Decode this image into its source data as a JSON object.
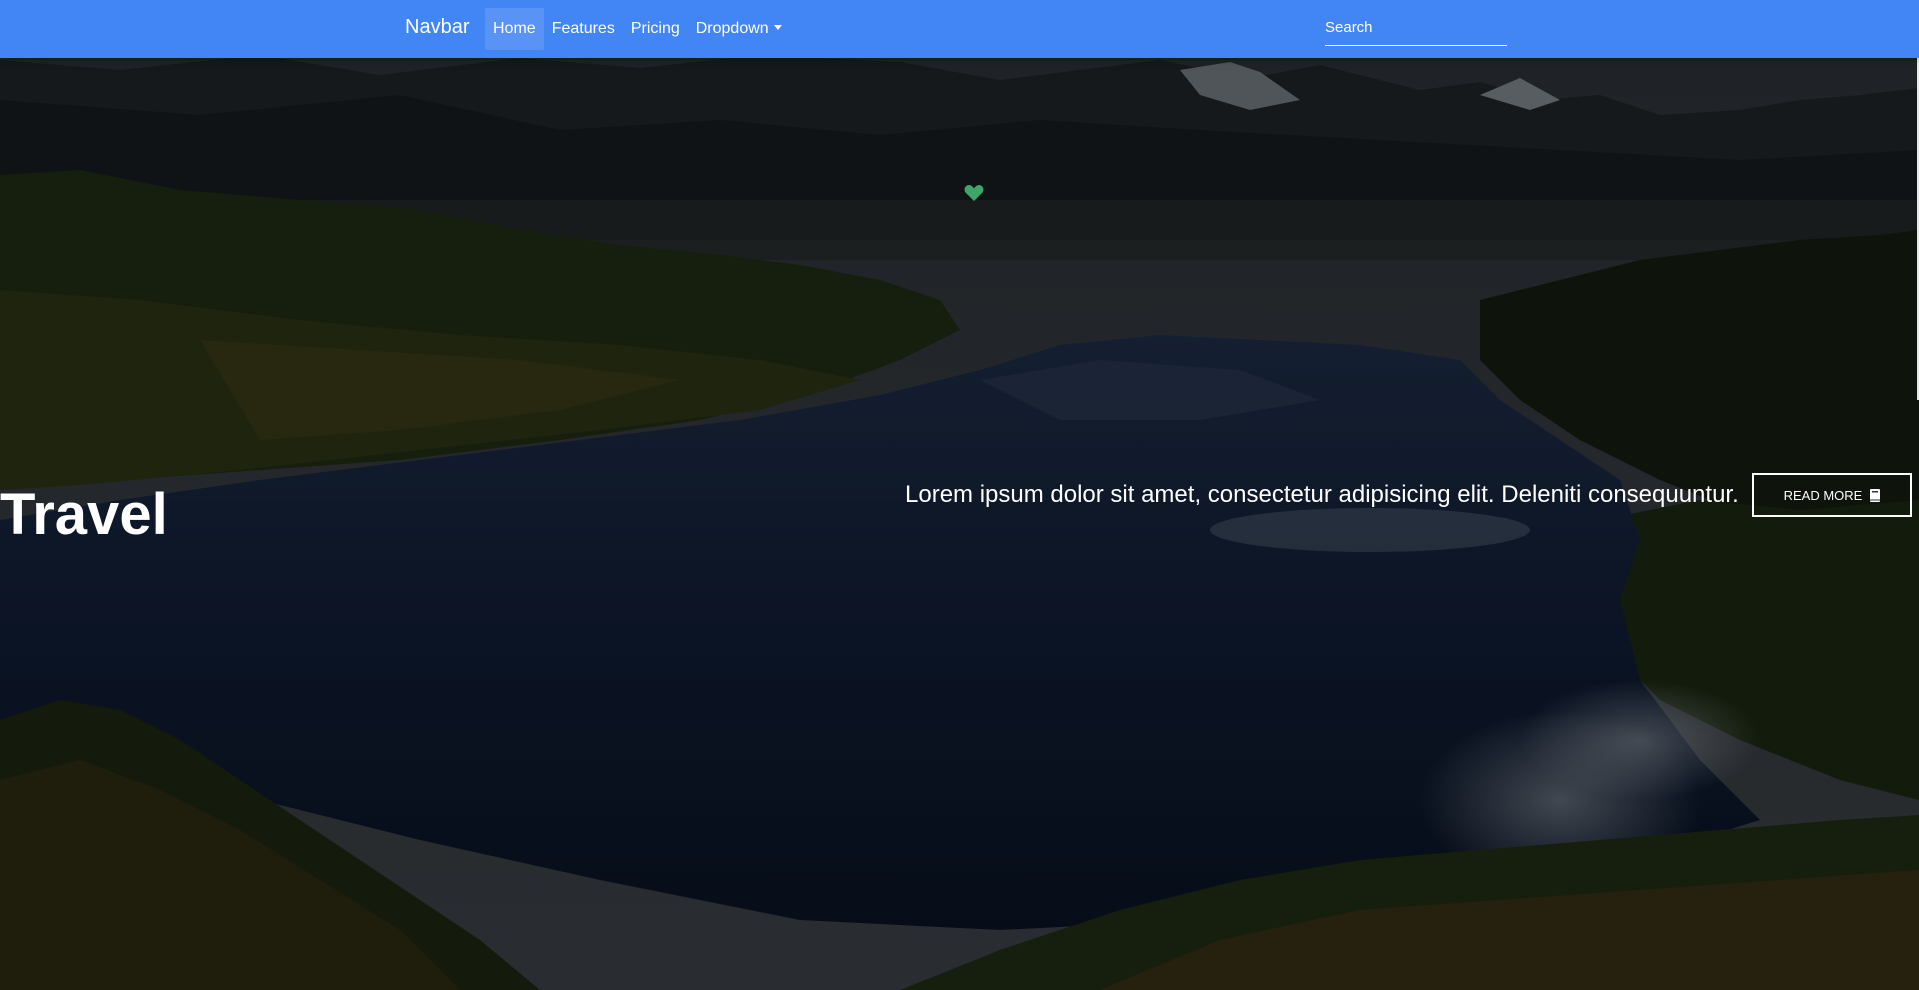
{
  "navbar": {
    "brand": "Navbar",
    "links": [
      {
        "label": "Home",
        "active": true
      },
      {
        "label": "Features",
        "active": false
      },
      {
        "label": "Pricing",
        "active": false
      },
      {
        "label": "Dropdown",
        "active": false
      }
    ],
    "search": {
      "placeholder": "Search"
    },
    "background_color": "#4285f4"
  },
  "hero": {
    "title": "Travel",
    "text": "Lorem ipsum dolor sit amet, consectetur adipisicing elit. Deleniti consequuntur.",
    "button_label": "Read more",
    "button_icon": "book-icon",
    "decorative_icon": "heart-icon",
    "heart_color": "#3fa66b"
  }
}
